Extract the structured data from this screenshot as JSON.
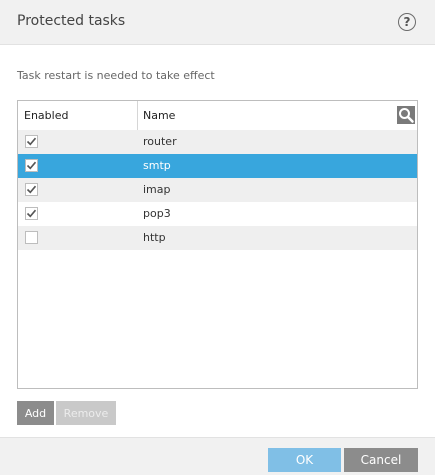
{
  "dialog": {
    "title": "Protected tasks",
    "help_label": "?",
    "notice": "Task restart is needed to take effect"
  },
  "table": {
    "columns": [
      "Enabled",
      "Name"
    ],
    "rows": [
      {
        "name": "router",
        "enabled": true,
        "selected": false
      },
      {
        "name": "smtp",
        "enabled": true,
        "selected": true
      },
      {
        "name": "imap",
        "enabled": true,
        "selected": false
      },
      {
        "name": "pop3",
        "enabled": true,
        "selected": false
      },
      {
        "name": "http",
        "enabled": false,
        "selected": false
      }
    ],
    "search_icon": "magnifier-icon"
  },
  "actions": {
    "add_label": "Add",
    "remove_label": "Remove",
    "remove_enabled": false
  },
  "footer": {
    "ok_label": "OK",
    "cancel_label": "Cancel"
  },
  "colors": {
    "selection": "#38a6dd",
    "ok_button": "#80bfe6",
    "neutral_button": "#8c8c8c"
  }
}
